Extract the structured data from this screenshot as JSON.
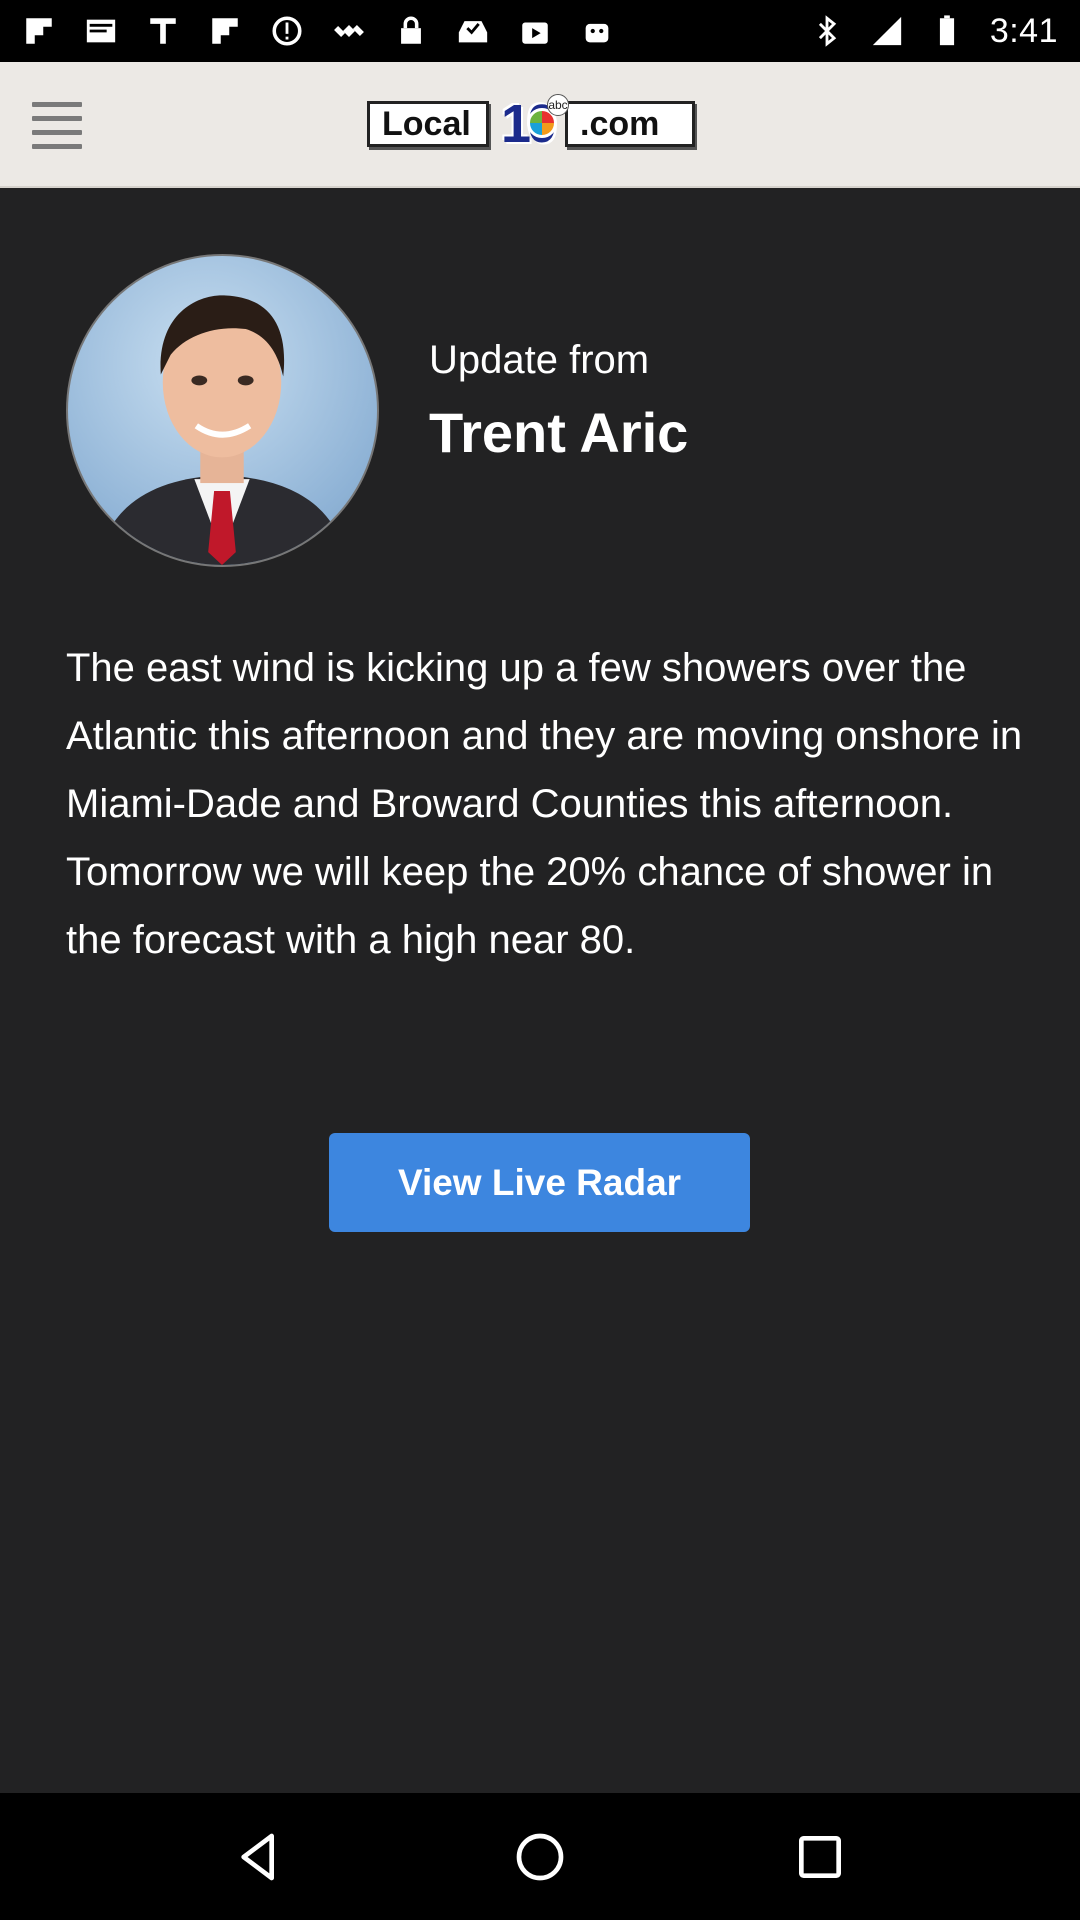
{
  "status_bar": {
    "time": "3:41",
    "left_icons": [
      "flipboard-icon",
      "mail-icon",
      "text-t-icon",
      "flipboard-icon",
      "alert-icon",
      "satellite-icon",
      "lock-icon",
      "inbox-check-icon",
      "play-store-icon",
      "android-icon"
    ],
    "right_icons": [
      "bluetooth-icon",
      "signal-icon",
      "battery-icon"
    ]
  },
  "header": {
    "menu_icon": "hamburger-menu-icon",
    "logo": {
      "left_text": "Local",
      "number": "10",
      "right_text": ".com",
      "badge": "abc"
    }
  },
  "article": {
    "kicker": "Update from",
    "author": "Trent Aric",
    "body": "The east wind is kicking up a few showers over the Atlantic this afternoon and they are moving onshore in Miami-Dade and Broward Counties this afternoon.  Tomorrow we will keep the 20% chance of shower in the forecast with a high near 80.",
    "button_label": "View Live Radar"
  },
  "nav_bar": {
    "icons": [
      "back-icon",
      "home-icon",
      "recents-icon"
    ]
  },
  "colors": {
    "background": "#222223",
    "header": "#ece9e5",
    "button": "#3d86df",
    "text": "#ffffff"
  }
}
